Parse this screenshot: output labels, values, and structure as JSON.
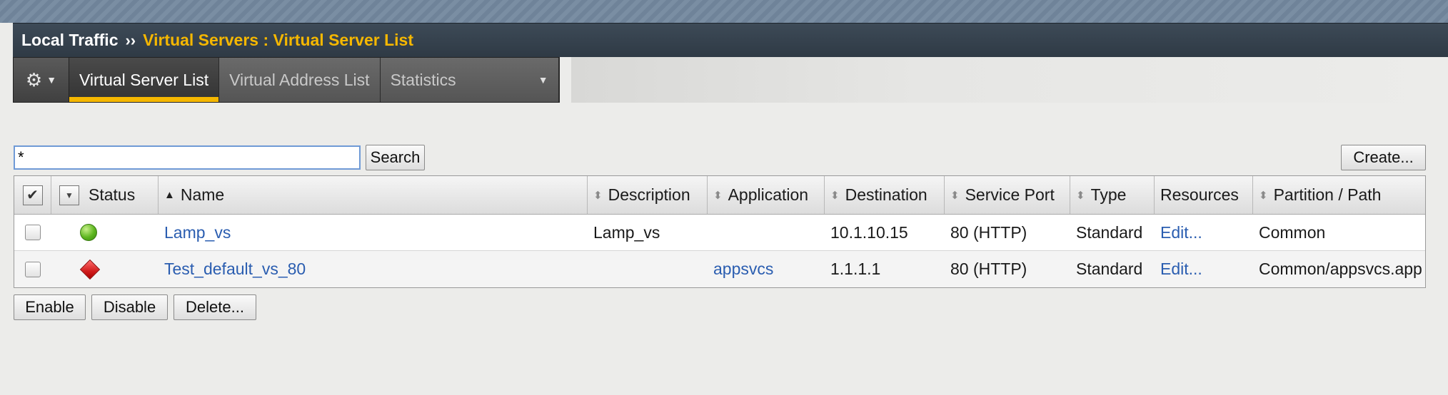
{
  "breadcrumb": {
    "root": "Local Traffic",
    "separator": "››",
    "current": "Virtual Servers : Virtual Server List"
  },
  "tabs": {
    "gear_icon": "gear-icon",
    "items": [
      {
        "label": "Virtual Server List",
        "active": true
      },
      {
        "label": "Virtual Address List",
        "active": false
      },
      {
        "label": "Statistics",
        "active": false
      }
    ]
  },
  "search": {
    "value": "*",
    "button_label": "Search"
  },
  "create_label": "Create...",
  "table": {
    "columns": {
      "status": "Status",
      "name": "Name",
      "description": "Description",
      "application": "Application",
      "destination": "Destination",
      "service_port": "Service Port",
      "type": "Type",
      "resources": "Resources",
      "partition": "Partition / Path"
    },
    "rows": [
      {
        "status": "available",
        "status_icon": "green-circle-icon",
        "name": "Lamp_vs",
        "description": "Lamp_vs",
        "application": "",
        "destination": "10.1.10.15",
        "service_port": "80 (HTTP)",
        "type": "Standard",
        "resources": "Edit...",
        "partition": "Common"
      },
      {
        "status": "offline",
        "status_icon": "red-diamond-icon",
        "name": "Test_default_vs_80",
        "description": "",
        "application": "appsvcs",
        "destination": "1.1.1.1",
        "service_port": "80 (HTTP)",
        "type": "Standard",
        "resources": "Edit...",
        "partition": "Common/appsvcs.app"
      }
    ]
  },
  "actions": {
    "enable": "Enable",
    "disable": "Disable",
    "delete": "Delete..."
  },
  "colors": {
    "accent": "#f5b700",
    "link": "#2a5db0",
    "header_bar": "#2f3a45"
  }
}
